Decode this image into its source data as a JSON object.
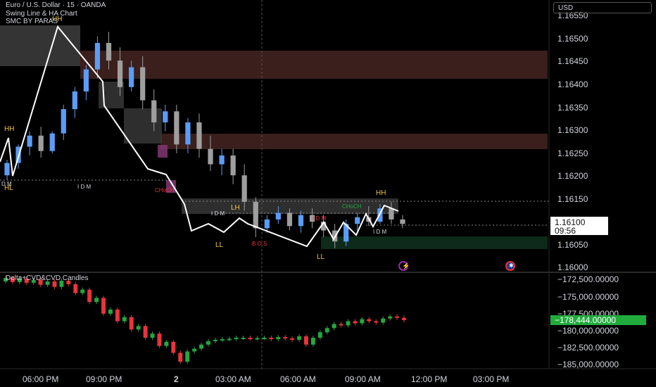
{
  "header": {
    "title_line": "Euro / U.S. Dollar · 15 · OANDA",
    "indicator_1": "Swing Line & HA Chart",
    "indicator_2": "SMC BY PARAS"
  },
  "currency_button": "USD",
  "lower_pane_title": "Delta+CVD&CVD Candles",
  "price_axis": {
    "labels": [
      "1.16550",
      "1.16500",
      "1.16450",
      "1.16400",
      "1.16350",
      "1.16300",
      "1.16250",
      "1.16200",
      "1.16150",
      "1.16100",
      "1.16050",
      "1.16000"
    ],
    "current_price": "1.16100",
    "countdown": "09:56"
  },
  "cvd_axis": {
    "labels": [
      "−172,500.00000",
      "−175,000.00000",
      "−177,500.00000",
      "−180,000.00000",
      "−182,500.00000",
      "−185,000.00000"
    ],
    "current_value": "−178,444.00000"
  },
  "time_axis": [
    "06:00 PM",
    "09:00 PM",
    "2",
    "03:00 AM",
    "06:00 AM",
    "09:00 AM",
    "12:00 PM",
    "03:00 PM"
  ],
  "smc_labels": {
    "hh_left": "HH",
    "hh_top": "HH",
    "hl_left": "HL",
    "dm_left": "D M",
    "idm_1": "I D M",
    "choch_1": "CHoCH",
    "idm_2": "I D M",
    "lh": "LH",
    "ll_1": "LL",
    "bos": "B O S",
    "idm_3": "I D M",
    "ll_2": "LL",
    "choch_2": "CHoCH",
    "hh_right": "HH",
    "idm_4": "I D M"
  },
  "colors": {
    "background": "#000000",
    "bull_candle": "#5b9cf6",
    "bear_candle": "#9e9e9e",
    "cvd_up": "#26a641",
    "cvd_down": "#e8343c",
    "supply_zone": "#3a1f1c",
    "demand_zone": "#0e2a1a",
    "swing_line": "#ffffff",
    "label_yellow": "#f0c43c"
  },
  "icons": [
    "lightning-icon",
    "gear-badge-icon"
  ],
  "chart_data": {
    "type": "candlestick",
    "y_range": [
      1.15985,
      1.16575
    ],
    "candles_ohlc": [
      [
        1.162,
        1.16235,
        1.1619,
        1.16228
      ],
      [
        1.16228,
        1.1627,
        1.16215,
        1.16265
      ],
      [
        1.16265,
        1.163,
        1.16245,
        1.1629
      ],
      [
        1.1629,
        1.1631,
        1.1624,
        1.16255
      ],
      [
        1.16255,
        1.163,
        1.1625,
        1.16295
      ],
      [
        1.16295,
        1.1636,
        1.1628,
        1.1635
      ],
      [
        1.1635,
        1.164,
        1.1633,
        1.1639
      ],
      [
        1.1639,
        1.1645,
        1.1637,
        1.1644
      ],
      [
        1.1644,
        1.16515,
        1.1642,
        1.165
      ],
      [
        1.165,
        1.16525,
        1.1644,
        1.1646
      ],
      [
        1.1646,
        1.1649,
        1.1638,
        1.164
      ],
      [
        1.164,
        1.1646,
        1.1639,
        1.16445
      ],
      [
        1.16445,
        1.1647,
        1.1635,
        1.1637
      ],
      [
        1.1637,
        1.16395,
        1.163,
        1.1632
      ],
      [
        1.1632,
        1.1636,
        1.163,
        1.16345
      ],
      [
        1.16345,
        1.1636,
        1.1625,
        1.1627
      ],
      [
        1.1627,
        1.1633,
        1.1625,
        1.1632
      ],
      [
        1.1632,
        1.1634,
        1.1624,
        1.1626
      ],
      [
        1.1626,
        1.1629,
        1.1621,
        1.16225
      ],
      [
        1.16225,
        1.1626,
        1.162,
        1.16245
      ],
      [
        1.16245,
        1.1626,
        1.1618,
        1.162
      ],
      [
        1.162,
        1.16225,
        1.1612,
        1.1614
      ],
      [
        1.1614,
        1.1615,
        1.1606,
        1.1608
      ],
      [
        1.1608,
        1.1611,
        1.1607,
        1.161
      ],
      [
        1.161,
        1.1613,
        1.1609,
        1.16115
      ],
      [
        1.16115,
        1.16125,
        1.16075,
        1.16085
      ],
      [
        1.16085,
        1.1612,
        1.1607,
        1.1611
      ],
      [
        1.1611,
        1.16125,
        1.1608,
        1.16095
      ],
      [
        1.16095,
        1.1611,
        1.1606,
        1.16075
      ],
      [
        1.16075,
        1.1609,
        1.16035,
        1.1605
      ],
      [
        1.1605,
        1.161,
        1.1604,
        1.1609
      ],
      [
        1.1609,
        1.16115,
        1.16075,
        1.16105
      ],
      [
        1.16105,
        1.1613,
        1.16085,
        1.16095
      ],
      [
        1.16095,
        1.16135,
        1.1609,
        1.16125
      ],
      [
        1.16125,
        1.1614,
        1.1609,
        1.161
      ],
      [
        1.161,
        1.1611,
        1.1608,
        1.1609
      ]
    ],
    "cvd_candles_oc": [
      [
        -172800,
        -172300
      ],
      [
        -172300,
        -172900
      ],
      [
        -172900,
        -172400
      ],
      [
        -172400,
        -173000
      ],
      [
        -173000,
        -172600
      ],
      [
        -172600,
        -173300
      ],
      [
        -173300,
        -172800
      ],
      [
        -172800,
        -173600
      ],
      [
        -173600,
        -172700
      ],
      [
        -172700,
        -173200
      ],
      [
        -173200,
        -174500
      ],
      [
        -174500,
        -174000
      ],
      [
        -174000,
        -175800
      ],
      [
        -175800,
        -175200
      ],
      [
        -175200,
        -177500
      ],
      [
        -177500,
        -176900
      ],
      [
        -176900,
        -178600
      ],
      [
        -178600,
        -178000
      ],
      [
        -178000,
        -179800
      ],
      [
        -179800,
        -179300
      ],
      [
        -179300,
        -181000
      ],
      [
        -181000,
        -180400
      ],
      [
        -180400,
        -182200
      ],
      [
        -182200,
        -181600
      ],
      [
        -181600,
        -183200
      ],
      [
        -183200,
        -184500
      ],
      [
        -184500,
        -183000
      ],
      [
        -183000,
        -182600
      ],
      [
        -182600,
        -182000
      ],
      [
        -182000,
        -181500
      ],
      [
        -181500,
        -181300
      ],
      [
        -181300,
        -181200
      ],
      [
        -181200,
        -181150
      ],
      [
        -181150,
        -181000
      ],
      [
        -181000,
        -181000
      ],
      [
        -181000,
        -181100
      ],
      [
        -181100,
        -181050
      ],
      [
        -181050,
        -181000
      ],
      [
        -181000,
        -181200
      ],
      [
        -181200,
        -180900
      ],
      [
        -180900,
        -181100
      ],
      [
        -181100,
        -181300
      ],
      [
        -181300,
        -180800
      ],
      [
        -180800,
        -182000
      ],
      [
        -182000,
        -181000
      ],
      [
        -181000,
        -180200
      ],
      [
        -180200,
        -179600
      ],
      [
        -179600,
        -179000
      ],
      [
        -179000,
        -179200
      ],
      [
        -179200,
        -178600
      ],
      [
        -178600,
        -178900
      ],
      [
        -178900,
        -178300
      ],
      [
        -178300,
        -178600
      ],
      [
        -178600,
        -178800
      ],
      [
        -178800,
        -178200
      ],
      [
        -178200,
        -177900
      ],
      [
        -177900,
        -178100
      ],
      [
        -178100,
        -178444
      ]
    ]
  }
}
